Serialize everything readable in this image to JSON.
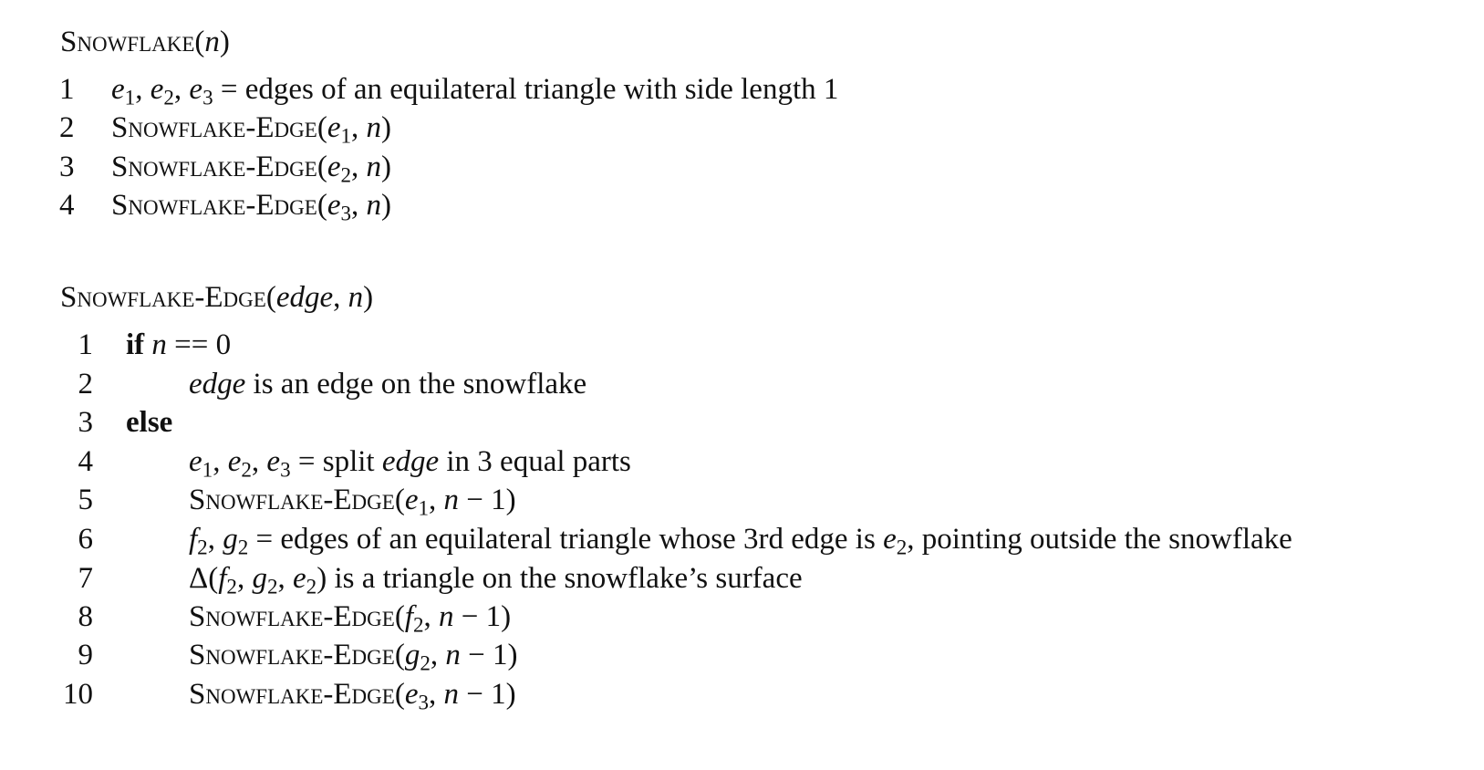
{
  "procedure1": {
    "title_name": "Snowflake",
    "title_args_open": "(",
    "title_arg_n": "n",
    "title_args_close": ")",
    "lines": [
      {
        "num": "1",
        "lhs": "e",
        "mid": " = ",
        "text": "edges of an equilateral triangle with side length ",
        "tail": "1"
      },
      {
        "num": "2",
        "call": "Snowflake-Edge",
        "arg": "e",
        "sub": "1",
        "rest": ", n)"
      },
      {
        "num": "3",
        "call": "Snowflake-Edge",
        "arg": "e",
        "sub": "2",
        "rest": ", n)"
      },
      {
        "num": "4",
        "call": "Snowflake-Edge",
        "arg": "e",
        "sub": "3",
        "rest": ", n)"
      }
    ]
  },
  "procedure2": {
    "title_name": "Snowflake-Edge",
    "title_arg_edge": "edge",
    "title_arg_n": "n",
    "line_numbers": [
      "1",
      "2",
      "3",
      "4",
      "5",
      "6",
      "7",
      "8",
      "9",
      "10"
    ],
    "if_kw": "if",
    "if_cond_var": "n",
    "if_cond_rest": " == 0",
    "line2_var": "edge",
    "line2_text": " is an edge on the snowflake",
    "else_kw": "else",
    "line4_mid": " = split ",
    "line4_var": "edge",
    "line4_text": " in 3 equal parts",
    "call_name": "Snowflake-Edge",
    "line6_mid": " = ",
    "line6_text": "edges of an equilateral triangle whose 3rd edge is ",
    "line6_tail": ", pointing outside the snowflake",
    "line7_delta": "Δ",
    "line7_text": " is a triangle on the snowflake’s surface",
    "n_minus_1": "n − 1"
  }
}
